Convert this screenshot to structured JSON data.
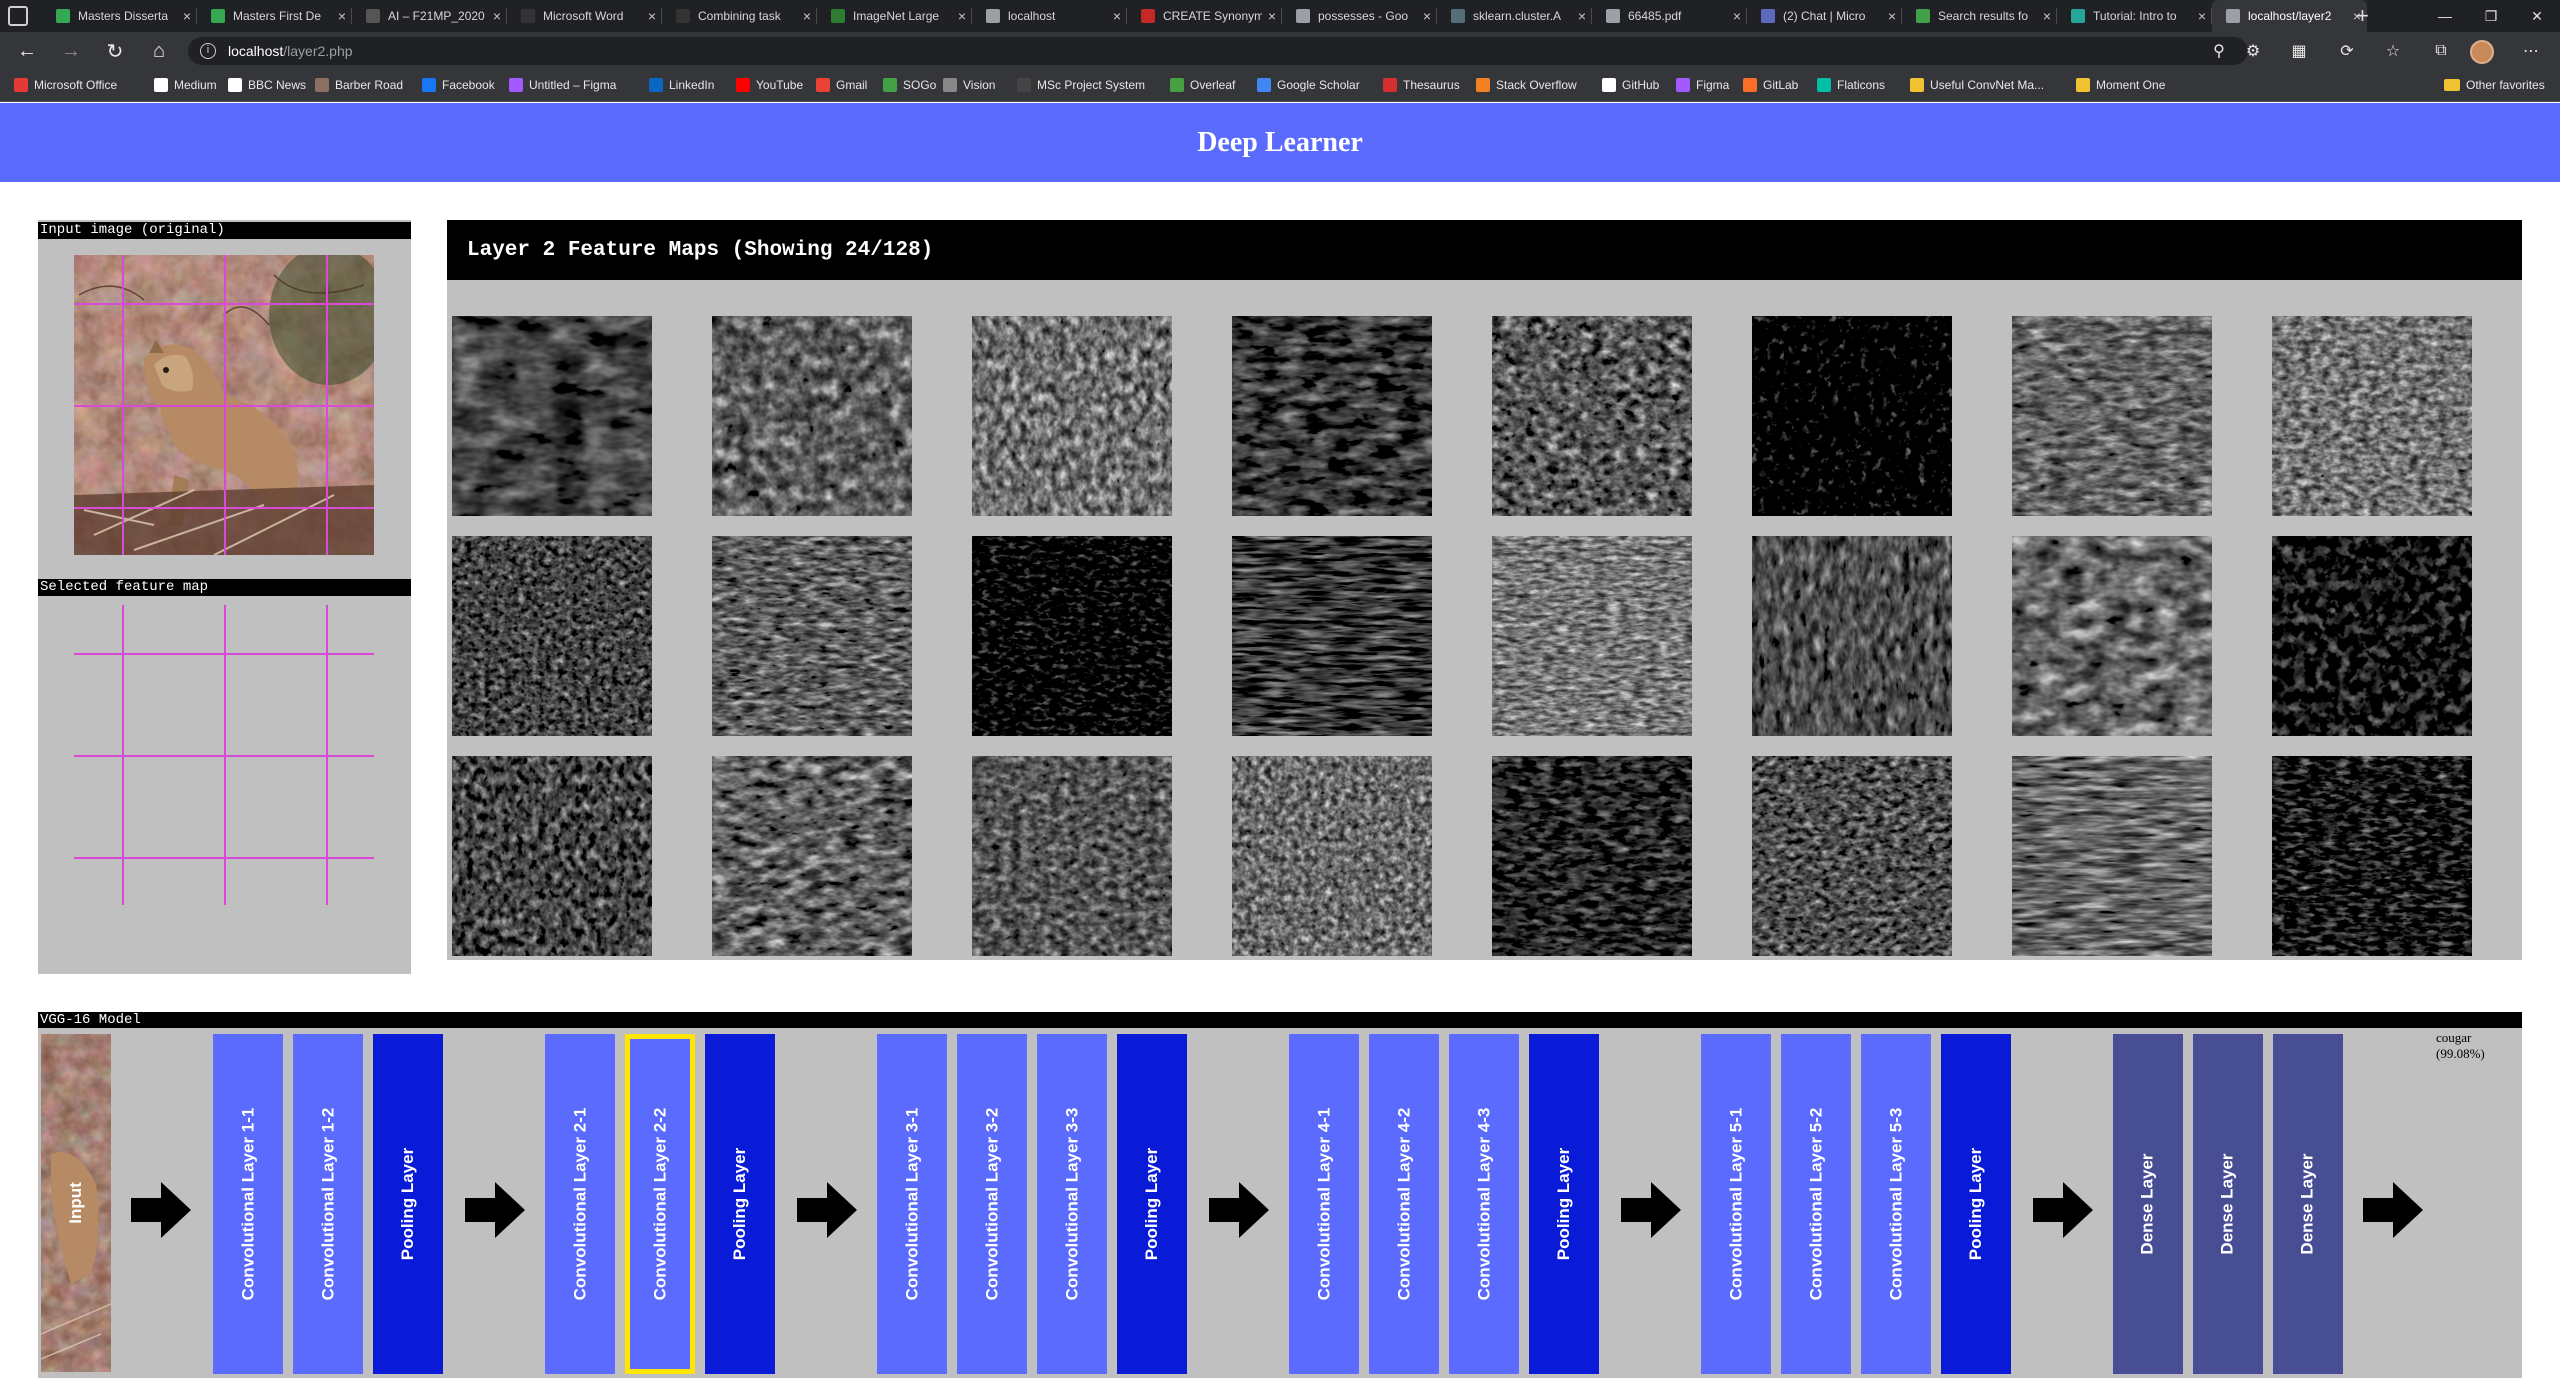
{
  "browser": {
    "tabs": [
      {
        "label": "Masters Disserta",
        "color": "#34a853"
      },
      {
        "label": "Masters First De",
        "color": "#34a853"
      },
      {
        "label": "AI – F21MP_2020",
        "color": "#555555"
      },
      {
        "label": "Microsoft Word",
        "color": "#333333"
      },
      {
        "label": "Combining task",
        "color": "#333333"
      },
      {
        "label": "ImageNet Large",
        "color": "#2e7d32"
      },
      {
        "label": "localhost",
        "color": "#9aa0a6"
      },
      {
        "label": "CREATE Synonym",
        "color": "#c62828"
      },
      {
        "label": "possesses - Goo",
        "color": "#9aa0a6"
      },
      {
        "label": "sklearn.cluster.A",
        "color": "#546e7a"
      },
      {
        "label": "66485.pdf",
        "color": "#9aa0a6"
      },
      {
        "label": "(2) Chat | Micro",
        "color": "#5c6bc0"
      },
      {
        "label": "Search results fo",
        "color": "#43a047"
      },
      {
        "label": "Tutorial: Intro to",
        "color": "#26a69a"
      },
      {
        "label": "localhost/layer2",
        "color": "#9aa0a6"
      }
    ],
    "active_tab_index": 14,
    "url_host": "localhost",
    "url_path": "/layer2.php",
    "bookmarks": [
      {
        "label": "Microsoft Office",
        "color": "#e53935"
      },
      {
        "label": "Medium",
        "color": "#ffffff"
      },
      {
        "label": "BBC News",
        "color": "#ffffff"
      },
      {
        "label": "Barber Road",
        "color": "#8d6e63"
      },
      {
        "label": "Facebook",
        "color": "#1877f2"
      },
      {
        "label": "Untitled – Figma",
        "color": "#a259ff"
      },
      {
        "label": "LinkedIn",
        "color": "#0a66c2"
      },
      {
        "label": "YouTube",
        "color": "#ff0000"
      },
      {
        "label": "Gmail",
        "color": "#ea4335"
      },
      {
        "label": "SOGo",
        "color": "#43a047"
      },
      {
        "label": "Vision",
        "color": "#888888"
      },
      {
        "label": "MSc Project System",
        "color": "#444444"
      },
      {
        "label": "Overleaf",
        "color": "#47a141"
      },
      {
        "label": "Google Scholar",
        "color": "#4285f4"
      },
      {
        "label": "Thesaurus",
        "color": "#d32f2f"
      },
      {
        "label": "Stack Overflow",
        "color": "#f48024"
      },
      {
        "label": "GitHub",
        "color": "#ffffff"
      },
      {
        "label": "Figma",
        "color": "#a259ff"
      },
      {
        "label": "GitLab",
        "color": "#fc6d26"
      },
      {
        "label": "Flaticons",
        "color": "#00bfa5"
      },
      {
        "label": "Useful ConvNet Ma...",
        "color": "#f1c232"
      },
      {
        "label": "Moment One",
        "color": "#f1c232"
      }
    ],
    "other_favorites": "Other favorites"
  },
  "page": {
    "title": "Deep Learner",
    "header_color": "#5b6bfd",
    "input_label": "Input image (original)",
    "selected_label": "Selected feature map",
    "feature_maps_title": "Layer 2 Feature Maps (Showing 24/128)",
    "feature_map_count": 24,
    "model_label": "VGG-16 Model",
    "input_block_label": "Input",
    "prediction_class": "cougar",
    "prediction_confidence": "(99.08%)"
  },
  "layers": [
    {
      "label": "Convolutional Layer 1-1",
      "kind": "conv"
    },
    {
      "label": "Convolutional Layer 1-2",
      "kind": "conv"
    },
    {
      "label": "Pooling Layer",
      "kind": "pool"
    },
    {
      "label": "Convolutional Layer 2-1",
      "kind": "conv"
    },
    {
      "label": "Convolutional Layer 2-2",
      "kind": "conv",
      "selected": true
    },
    {
      "label": "Pooling Layer",
      "kind": "pool"
    },
    {
      "label": "Convolutional Layer 3-1",
      "kind": "conv"
    },
    {
      "label": "Convolutional Layer 3-2",
      "kind": "conv"
    },
    {
      "label": "Convolutional Layer 3-3",
      "kind": "conv"
    },
    {
      "label": "Pooling Layer",
      "kind": "pool"
    },
    {
      "label": "Convolutional Layer 4-1",
      "kind": "conv"
    },
    {
      "label": "Convolutional Layer 4-2",
      "kind": "conv"
    },
    {
      "label": "Convolutional Layer 4-3",
      "kind": "conv"
    },
    {
      "label": "Pooling Layer",
      "kind": "pool"
    },
    {
      "label": "Convolutional Layer 5-1",
      "kind": "conv"
    },
    {
      "label": "Convolutional Layer 5-2",
      "kind": "conv"
    },
    {
      "label": "Convolutional Layer 5-3",
      "kind": "conv"
    },
    {
      "label": "Pooling Layer",
      "kind": "pool"
    },
    {
      "label": "Dense Layer",
      "kind": "dense"
    },
    {
      "label": "Dense Layer",
      "kind": "dense"
    },
    {
      "label": "Dense Layer",
      "kind": "dense"
    }
  ],
  "colors": {
    "conv": "#5b6bfd",
    "pool": "#0a1bd8",
    "dense": "#474e94",
    "selected_outline": "#ffe600",
    "grid_overlay": "#d94ad6",
    "panel_bg": "#c0c0c0"
  }
}
